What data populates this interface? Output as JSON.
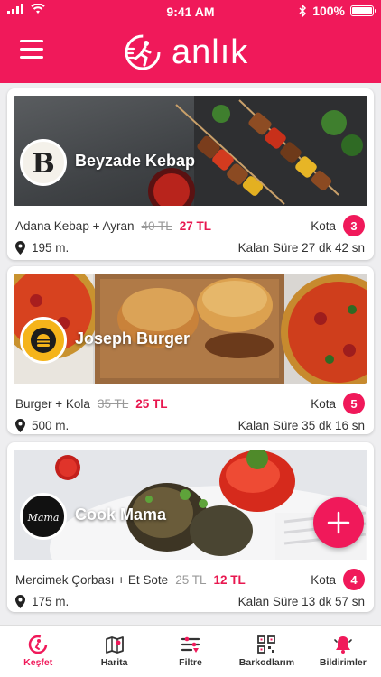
{
  "status_bar": {
    "time": "9:41 AM",
    "battery": "100%"
  },
  "header": {
    "brand": "anlık"
  },
  "cards": [
    {
      "name": "Beyzade Kebap",
      "deal": "Adana Kebap + Ayran",
      "old_price": "40 TL",
      "new_price": "27 TL",
      "quota_label": "Kota",
      "quota": "3",
      "distance": "195 m.",
      "remaining": "Kalan Süre 27 dk 42 sn"
    },
    {
      "name": "Joseph Burger",
      "deal": "Burger + Kola",
      "old_price": "35 TL",
      "new_price": "25 TL",
      "quota_label": "Kota",
      "quota": "5",
      "distance": "500 m.",
      "remaining": "Kalan Süre 35 dk 16 sn"
    },
    {
      "name": "Cook Mama",
      "deal": "Mercimek Çorbası + Et Sote",
      "old_price": "25 TL",
      "new_price": "12 TL",
      "quota_label": "Kota",
      "quota": "4",
      "distance": "175 m.",
      "remaining": "Kalan Süre 13 dk 57 sn"
    }
  ],
  "logos": {
    "beyzade": "B",
    "cook_mama": "Mama"
  },
  "tabs": [
    {
      "label": "Keşfet",
      "icon": "discover-icon",
      "active": true
    },
    {
      "label": "Harita",
      "icon": "map-icon"
    },
    {
      "label": "Filtre",
      "icon": "filter-icon"
    },
    {
      "label": "Barkodlarım",
      "icon": "qr-code-icon"
    },
    {
      "label": "Bildirimler",
      "icon": "bell-icon"
    }
  ],
  "colors": {
    "brand": "#f0195a",
    "price": "#e8174f"
  }
}
